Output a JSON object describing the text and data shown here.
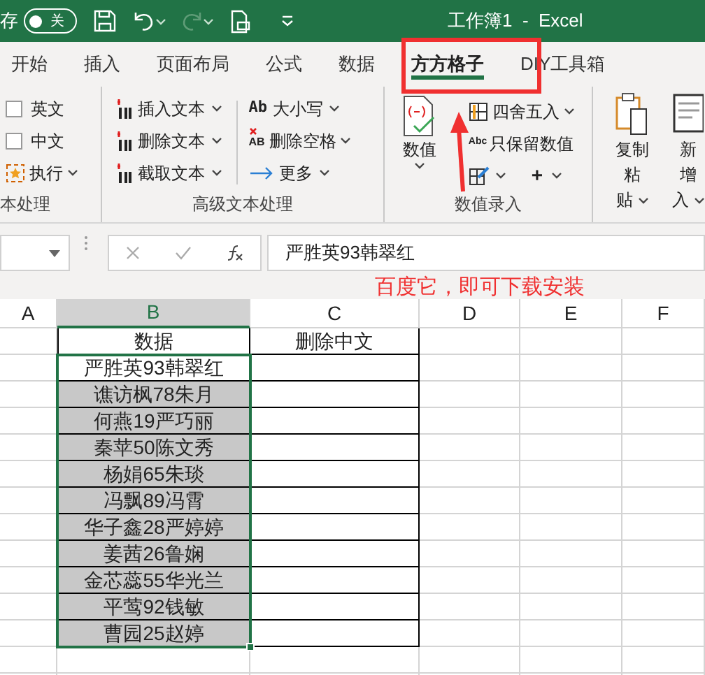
{
  "title_bar": {
    "autosave_label": "存",
    "autosave_toggle": {
      "label": "关",
      "on": false
    },
    "redo_disabled": true,
    "title": "工作簿1  -  Excel"
  },
  "tabs": [
    {
      "label": "开始",
      "selected": false
    },
    {
      "label": "插入",
      "selected": false
    },
    {
      "label": "页面布局",
      "selected": false
    },
    {
      "label": "公式",
      "selected": false
    },
    {
      "label": "数据",
      "selected": false
    },
    {
      "label": "方方格子",
      "selected": true
    },
    {
      "label": "DIY工具箱",
      "selected": false
    }
  ],
  "ribbon": {
    "text_group": {
      "checkboxes": [
        {
          "label": "英文",
          "checked": false
        },
        {
          "label": "中文",
          "checked": false
        }
      ],
      "run": "执行",
      "label": "本处理"
    },
    "advanced_group": {
      "left": [
        "插入文本",
        "删除文本",
        "截取文本"
      ],
      "case": {
        "icon_text": "Ab",
        "label": "大小写"
      },
      "trim": {
        "icon_text": "AB",
        "label": "删除空格"
      },
      "more": "更多",
      "label": "高级文本处理"
    },
    "number_group": {
      "big": "数值",
      "round": "四舍五入",
      "keep": {
        "icon_text": "Abc",
        "label": "只保留数值"
      },
      "plus": "+",
      "label": "数值录入"
    },
    "copy_group": {
      "copy": [
        "复制粘",
        "贴"
      ],
      "insert": [
        "新增",
        "入"
      ]
    }
  },
  "formula_bar": {
    "value": "严胜英93韩翠红"
  },
  "annotation": {
    "note": "百度它，即可下载安装"
  },
  "sheet": {
    "columns": [
      {
        "label": "A",
        "selected": false
      },
      {
        "label": "B",
        "selected": true
      },
      {
        "label": "C",
        "selected": false
      },
      {
        "label": "D",
        "selected": false
      },
      {
        "label": "E",
        "selected": false
      },
      {
        "label": "F",
        "selected": false
      }
    ],
    "rows": [
      {
        "b": "数据",
        "c": "删除中文",
        "selected": false
      },
      {
        "b": "严胜英93韩翠红",
        "selected": false
      },
      {
        "b": "谯访枫78朱月",
        "selected": true
      },
      {
        "b": "何燕19严巧丽",
        "selected": true
      },
      {
        "b": "秦苹50陈文秀",
        "selected": true
      },
      {
        "b": "杨娟65朱琰",
        "selected": true
      },
      {
        "b": "冯飘89冯霄",
        "selected": true
      },
      {
        "b": "华子鑫28严婷婷",
        "selected": true
      },
      {
        "b": "姜茜26鲁娴",
        "selected": true
      },
      {
        "b": "金芯蕊55华光兰",
        "selected": true
      },
      {
        "b": "平莺92钱敏",
        "selected": true
      },
      {
        "b": "曹园25赵婷",
        "selected": true
      }
    ]
  }
}
